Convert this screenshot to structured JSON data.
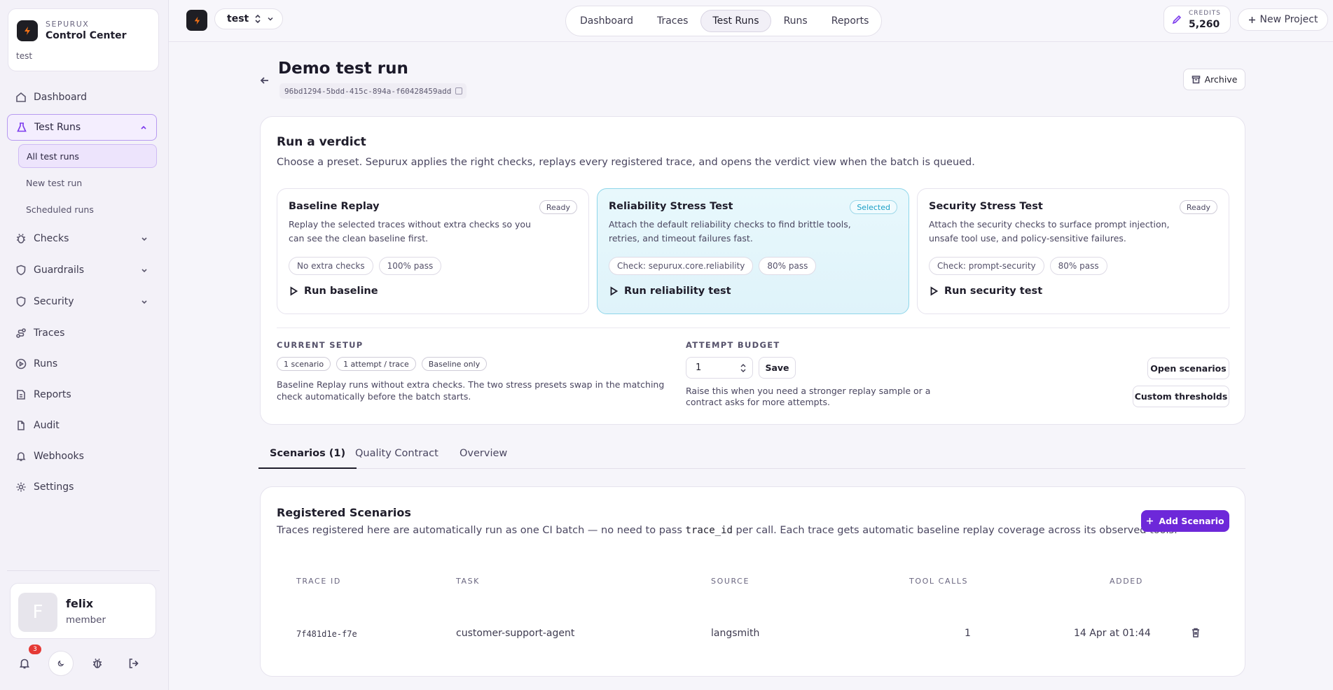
{
  "brand": {
    "kicker": "SEPURUX",
    "title": "Control Center",
    "project": "test"
  },
  "sidebar": {
    "items": [
      {
        "label": "Dashboard"
      },
      {
        "label": "Test Runs"
      },
      {
        "label": "Checks"
      },
      {
        "label": "Guardrails"
      },
      {
        "label": "Security"
      },
      {
        "label": "Traces"
      },
      {
        "label": "Runs"
      },
      {
        "label": "Reports"
      },
      {
        "label": "Audit"
      },
      {
        "label": "Webhooks"
      },
      {
        "label": "Settings"
      }
    ],
    "sub_items": [
      {
        "label": "All test runs"
      },
      {
        "label": "New test run"
      },
      {
        "label": "Scheduled runs"
      }
    ]
  },
  "user": {
    "initial": "F",
    "name": "felix",
    "role": "member",
    "notifications": "3"
  },
  "topbar": {
    "project": "test",
    "nav": [
      {
        "label": "Dashboard"
      },
      {
        "label": "Traces"
      },
      {
        "label": "Test Runs"
      },
      {
        "label": "Runs"
      },
      {
        "label": "Reports"
      }
    ],
    "credits_label": "CREDITS",
    "credits_value": "5,260",
    "new_project": "New Project"
  },
  "header": {
    "title": "Demo test run",
    "run_id": "96bd1294-5bdd-415c-894a-f60428459add",
    "archive": "Archive"
  },
  "verdict": {
    "title": "Run a verdict",
    "description": "Choose a preset. Sepurux applies the right checks, replays every registered trace, and opens the verdict view when the batch is queued.",
    "presets": [
      {
        "title": "Baseline Replay",
        "status": "Ready",
        "description": "Replay the selected traces without extra checks so you can see the clean baseline first.",
        "chips": [
          "No extra checks",
          "100% pass"
        ],
        "action": "Run baseline"
      },
      {
        "title": "Reliability Stress Test",
        "status": "Selected",
        "description": "Attach the default reliability checks to find brittle tools, retries, and timeout failures fast.",
        "chips": [
          "Check: sepurux.core.reliability",
          "80% pass"
        ],
        "action": "Run reliability test"
      },
      {
        "title": "Security Stress Test",
        "status": "Ready",
        "description": "Attach the security checks to surface prompt injection, unsafe tool use, and policy-sensitive failures.",
        "chips": [
          "Check: prompt-security",
          "80% pass"
        ],
        "action": "Run security test"
      }
    ],
    "setup_label": "CURRENT SETUP",
    "setup_chips": [
      "1 scenario",
      "1 attempt / trace",
      "Baseline only"
    ],
    "setup_note": "Baseline Replay runs without extra checks. The two stress presets swap in the matching check automatically before the batch starts.",
    "budget_label": "ATTEMPT BUDGET",
    "budget_value": "1",
    "save": "Save",
    "budget_note": "Raise this when you need a stronger replay sample or a contract asks for more attempts.",
    "open_scenarios": "Open scenarios",
    "custom_thresholds": "Custom thresholds"
  },
  "tabs": [
    {
      "label": "Scenarios (1)"
    },
    {
      "label": "Quality Contract"
    },
    {
      "label": "Overview"
    }
  ],
  "scenarios": {
    "title": "Registered Scenarios",
    "desc_pre": "Traces registered here are automatically run as one CI batch — no need to pass ",
    "desc_code": "trace_id",
    "desc_post": " per call. Each trace gets automatic baseline replay coverage across its observed tools.",
    "add": "Add Scenario",
    "columns": [
      "TRACE ID",
      "TASK",
      "SOURCE",
      "TOOL CALLS",
      "ADDED"
    ],
    "rows": [
      {
        "trace_id": "7f481d1e-f7e",
        "task": "customer-support-agent",
        "source": "langsmith",
        "tool_calls": "1",
        "added": "14 Apr at 01:44"
      }
    ]
  }
}
